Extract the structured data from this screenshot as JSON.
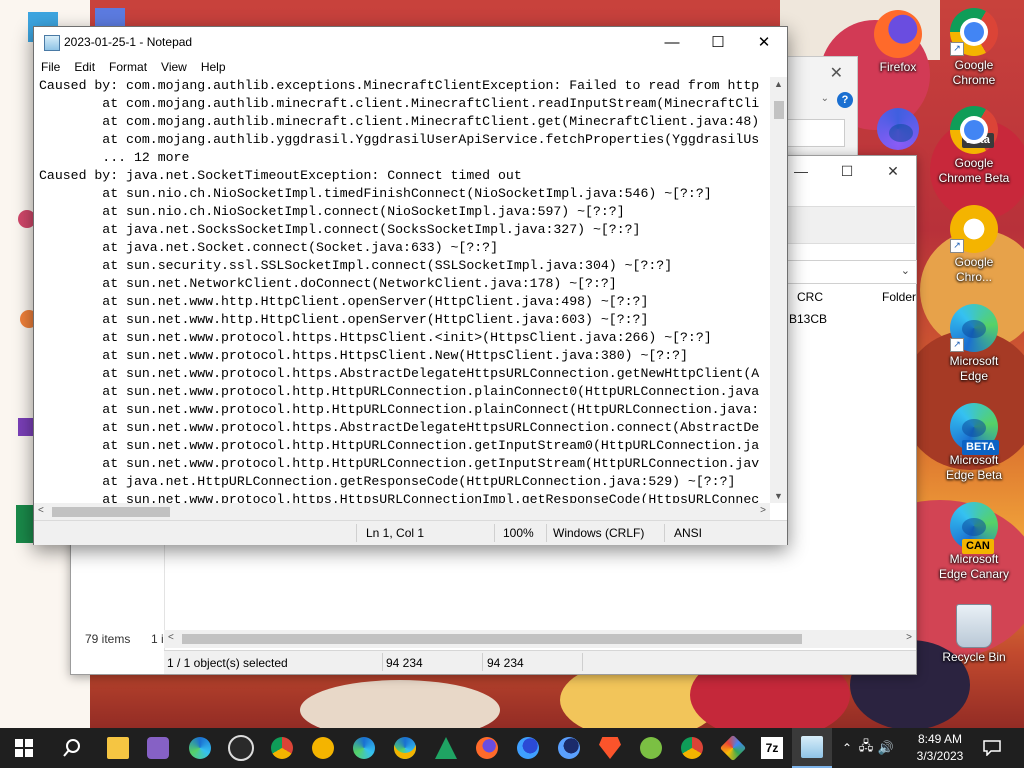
{
  "desktop": {
    "icons": [
      {
        "label": "Firefox",
        "kind": "firefox"
      },
      {
        "label": "Google Chrome",
        "kind": "chrome"
      },
      {
        "label": "Google Chrome Beta",
        "kind": "chrome-beta",
        "badge": "Beta"
      },
      {
        "label": "Google Chro...",
        "kind": "chrome-canary"
      },
      {
        "label": "Microsoft Edge",
        "kind": "edge"
      },
      {
        "label": "Microsoft Edge Beta",
        "kind": "edge-beta",
        "badge": "BETA"
      },
      {
        "label": "Microsoft Edge Canary",
        "kind": "edge-canary",
        "badge": "CAN"
      },
      {
        "label": "Recycle Bin",
        "kind": "recycle-bin"
      }
    ]
  },
  "zip_window": {
    "columns": [
      "CRC",
      "Folder"
    ],
    "crc_value": "B13CB",
    "items_count": "79 items",
    "left_status": "1 i",
    "status": {
      "selected": "1 / 1 object(s) selected",
      "size1": "94 234",
      "size2": "94 234"
    }
  },
  "notepad": {
    "title": "2023-01-25-1 - Notepad",
    "menu": [
      "File",
      "Edit",
      "Format",
      "View",
      "Help"
    ],
    "lines": [
      "Caused by: com.mojang.authlib.exceptions.MinecraftClientException: Failed to read from http",
      "        at com.mojang.authlib.minecraft.client.MinecraftClient.readInputStream(MinecraftCli",
      "        at com.mojang.authlib.minecraft.client.MinecraftClient.get(MinecraftClient.java:48)",
      "        at com.mojang.authlib.yggdrasil.YggdrasilUserApiService.fetchProperties(YggdrasilUs",
      "        ... 12 more",
      "Caused by: java.net.SocketTimeoutException: Connect timed out",
      "        at sun.nio.ch.NioSocketImpl.timedFinishConnect(NioSocketImpl.java:546) ~[?:?]",
      "        at sun.nio.ch.NioSocketImpl.connect(NioSocketImpl.java:597) ~[?:?]",
      "        at java.net.SocksSocketImpl.connect(SocksSocketImpl.java:327) ~[?:?]",
      "        at java.net.Socket.connect(Socket.java:633) ~[?:?]",
      "        at sun.security.ssl.SSLSocketImpl.connect(SSLSocketImpl.java:304) ~[?:?]",
      "        at sun.net.NetworkClient.doConnect(NetworkClient.java:178) ~[?:?]",
      "        at sun.net.www.http.HttpClient.openServer(HttpClient.java:498) ~[?:?]",
      "        at sun.net.www.http.HttpClient.openServer(HttpClient.java:603) ~[?:?]",
      "        at sun.net.www.protocol.https.HttpsClient.<init>(HttpsClient.java:266) ~[?:?]",
      "        at sun.net.www.protocol.https.HttpsClient.New(HttpsClient.java:380) ~[?:?]",
      "        at sun.net.www.protocol.https.AbstractDelegateHttpsURLConnection.getNewHttpClient(A",
      "        at sun.net.www.protocol.http.HttpURLConnection.plainConnect0(HttpURLConnection.java",
      "        at sun.net.www.protocol.http.HttpURLConnection.plainConnect(HttpURLConnection.java:",
      "        at sun.net.www.protocol.https.AbstractDelegateHttpsURLConnection.connect(AbstractDe",
      "        at sun.net.www.protocol.http.HttpURLConnection.getInputStream0(HttpURLConnection.ja",
      "        at sun.net.www.protocol.http.HttpURLConnection.getInputStream(HttpURLConnection.jav",
      "        at java.net.HttpURLConnection.getResponseCode(HttpURLConnection.java:529) ~[?:?]",
      "        at sun.net.www.protocol.https.HttpsURLConnectionImpl.getResponseCode(HttpsURLConnec"
    ],
    "status": {
      "position": "Ln 1, Col 1",
      "zoom": "100%",
      "line_ending": "Windows (CRLF)",
      "encoding": "ANSI"
    }
  },
  "taskbar": {
    "apps": [
      "file-explorer",
      "visual-studio",
      "edge",
      "obs",
      "chrome-beta",
      "chrome-canary",
      "edge-beta",
      "edge-canary",
      "sheets",
      "firefox",
      "firefox-dev",
      "firefox-nightly",
      "brave",
      "app-green",
      "chrome",
      "app-multicolor",
      "7zip",
      "notepad"
    ],
    "time": "8:49 AM",
    "date": "3/3/2023"
  },
  "colors": {
    "taskbar": "#1f1f1f",
    "accent": "#7eb4ea"
  }
}
